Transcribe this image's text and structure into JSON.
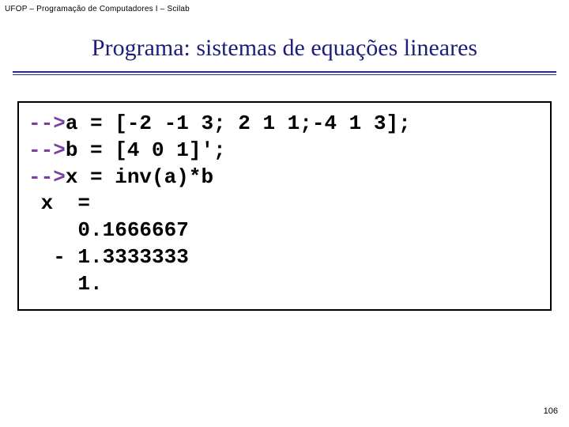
{
  "header": {
    "label": "UFOP – Programação de Computadores I – Scilab"
  },
  "title": "Programa: sistemas de equações lineares",
  "code": {
    "l1a": "-->",
    "l1b": "a = [-2 -1 3; 2 1 1;-4 1 3];",
    "l2a": "-->",
    "l2b": "b = [4 0 1]';",
    "l3a": "-->",
    "l3b": "x = inv(a)*b",
    "l4": " x  =",
    "l5": "    0.1666667",
    "l6": "  - 1.3333333",
    "l7": "    1."
  },
  "page_number": "106"
}
